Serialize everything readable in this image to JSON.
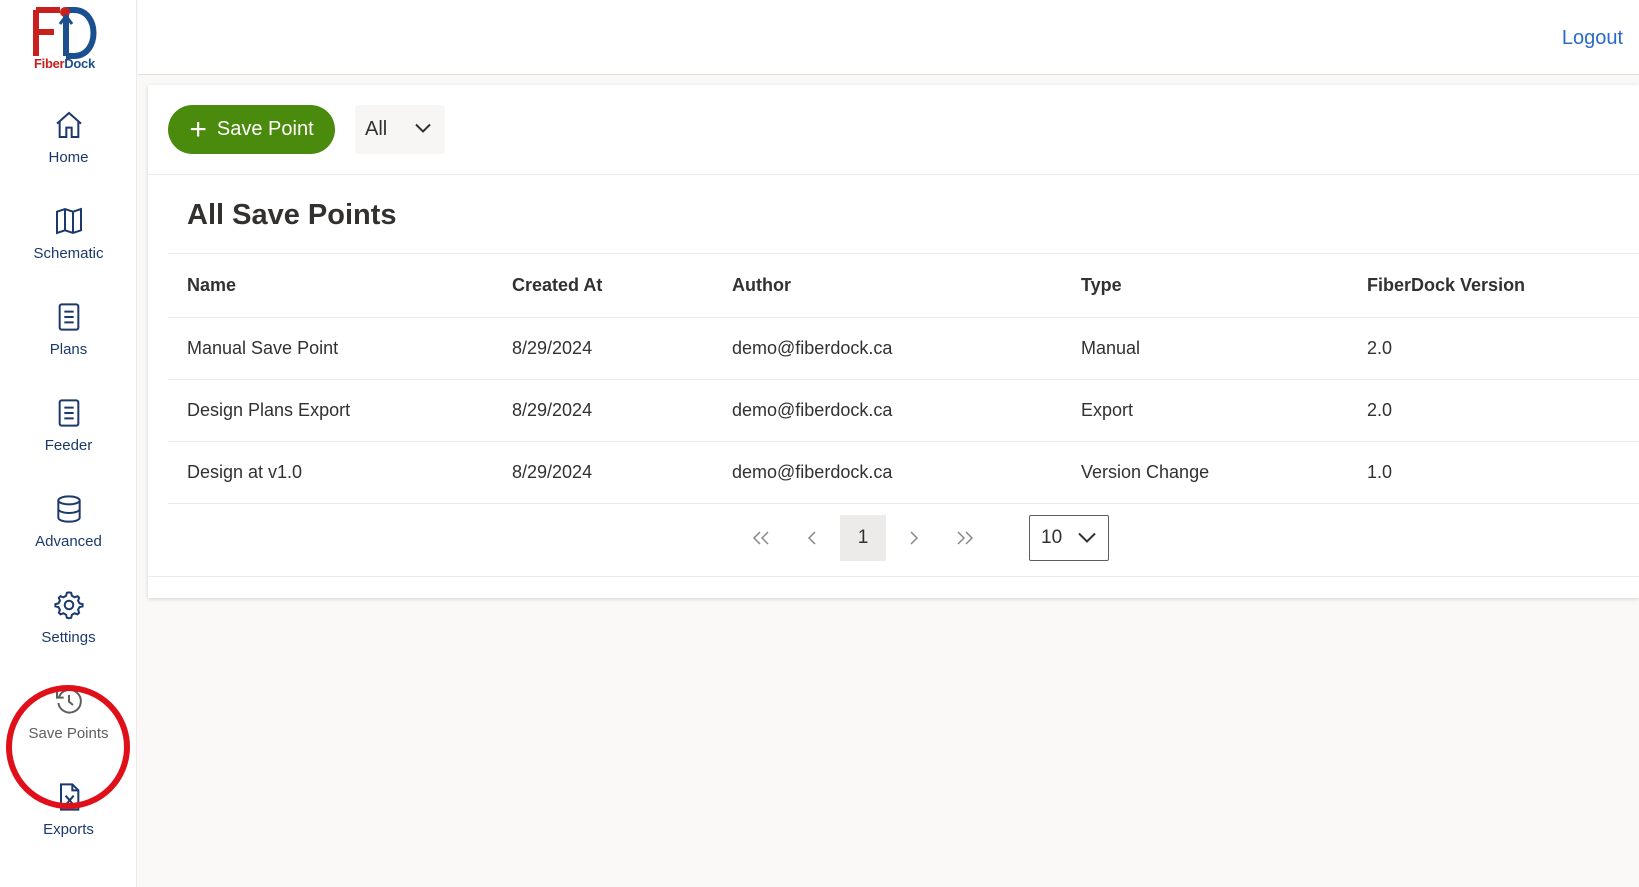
{
  "brand": {
    "logo_fiber": "Fiber",
    "logo_dock": "Dock",
    "logo_letters": "FD"
  },
  "colors": {
    "accent_green": "#4a8a0c",
    "nav_blue": "#1b3a6b",
    "link_blue": "#2b6cc4",
    "highlight_red": "#e0101a"
  },
  "sidebar": {
    "items": [
      {
        "label": "Home",
        "icon": "home-icon"
      },
      {
        "label": "Schematic",
        "icon": "map-icon"
      },
      {
        "label": "Plans",
        "icon": "document-icon"
      },
      {
        "label": "Feeder",
        "icon": "document-icon"
      },
      {
        "label": "Advanced",
        "icon": "database-icon"
      },
      {
        "label": "Settings",
        "icon": "gear-icon"
      },
      {
        "label": "Save Points",
        "icon": "history-icon",
        "active": true
      },
      {
        "label": "Exports",
        "icon": "excel-file-icon"
      }
    ]
  },
  "header": {
    "logout_label": "Logout"
  },
  "toolbar": {
    "add_button_label": "Save Point",
    "filter_value": "All"
  },
  "main": {
    "title": "All Save Points",
    "columns": [
      "Name",
      "Created At",
      "Author",
      "Type",
      "FiberDock Version"
    ],
    "rows": [
      [
        "Manual Save Point",
        "8/29/2024",
        "demo@fiberdock.ca",
        "Manual",
        "2.0"
      ],
      [
        "Design Plans Export",
        "8/29/2024",
        "demo@fiberdock.ca",
        "Export",
        "2.0"
      ],
      [
        "Design at v1.0",
        "8/29/2024",
        "demo@fiberdock.ca",
        "Version Change",
        "1.0"
      ]
    ]
  },
  "pagination": {
    "current_page": "1",
    "page_size": "10"
  }
}
